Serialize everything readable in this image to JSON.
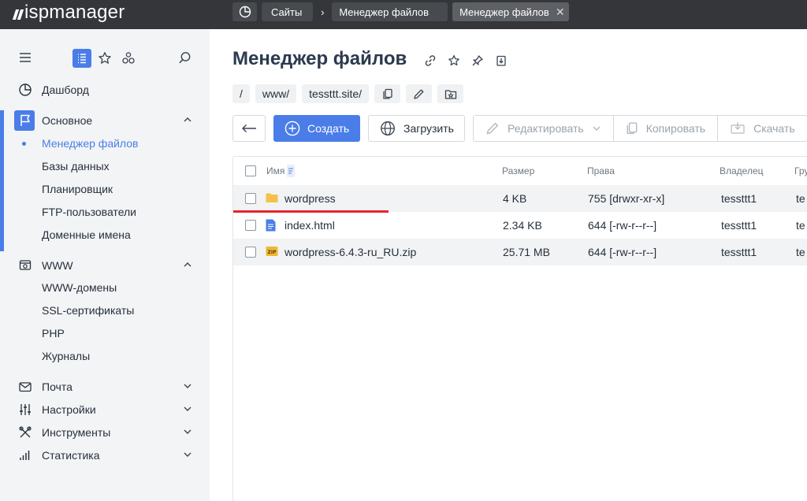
{
  "app": {
    "logo_text": "ispmanager"
  },
  "tabs": [
    {
      "label": "",
      "icon": "dashboard-icon"
    },
    {
      "label": "Сайты"
    },
    {
      "label": "Менеджер файлов"
    },
    {
      "label": "Менеджер файлов",
      "active": true
    }
  ],
  "sidebar": {
    "dashboard": "Дашборд",
    "main_section": {
      "label": "Основное",
      "items": [
        "Менеджер файлов",
        "Базы данных",
        "Планировщик",
        "FTP-пользователи",
        "Доменные имена"
      ],
      "active_index": 0
    },
    "www_section": {
      "label": "WWW",
      "items": [
        "WWW-домены",
        "SSL-сертификаты",
        "PHP",
        "Журналы"
      ]
    },
    "mail": "Почта",
    "settings": "Настройки",
    "tools": "Инструменты",
    "stats": "Статистика"
  },
  "page": {
    "title": "Менеджер файлов",
    "path": [
      "/",
      "www/",
      "tessttt.site/"
    ]
  },
  "toolbar": {
    "create": "Создать",
    "upload": "Загрузить",
    "edit": "Редактировать",
    "copy": "Копировать",
    "download": "Скачать"
  },
  "table": {
    "columns": {
      "name": "Имя",
      "size": "Размер",
      "perms": "Права",
      "owner": "Владелец",
      "group": "Гру"
    },
    "rows": [
      {
        "name": "wordpress",
        "size": "4 KB",
        "perms": "755 [drwxr-xr-x]",
        "owner": "tessttt1",
        "group": "te",
        "icon": "folder-icon"
      },
      {
        "name": "index.html",
        "size": "2.34 KB",
        "perms": "644 [-rw-r--r--]",
        "owner": "tessttt1",
        "group": "te",
        "icon": "html-file-icon"
      },
      {
        "name": "wordpress-6.4.3-ru_RU.zip",
        "size": "25.71 MB",
        "perms": "644 [-rw-r--r--]",
        "owner": "tessttt1",
        "group": "te",
        "icon": "zip-file-icon"
      }
    ]
  },
  "colors": {
    "accent": "#4a7de8",
    "topbar": "#343639",
    "sidebar": "#f3f4f5",
    "highlight_line": "#e8242a"
  }
}
